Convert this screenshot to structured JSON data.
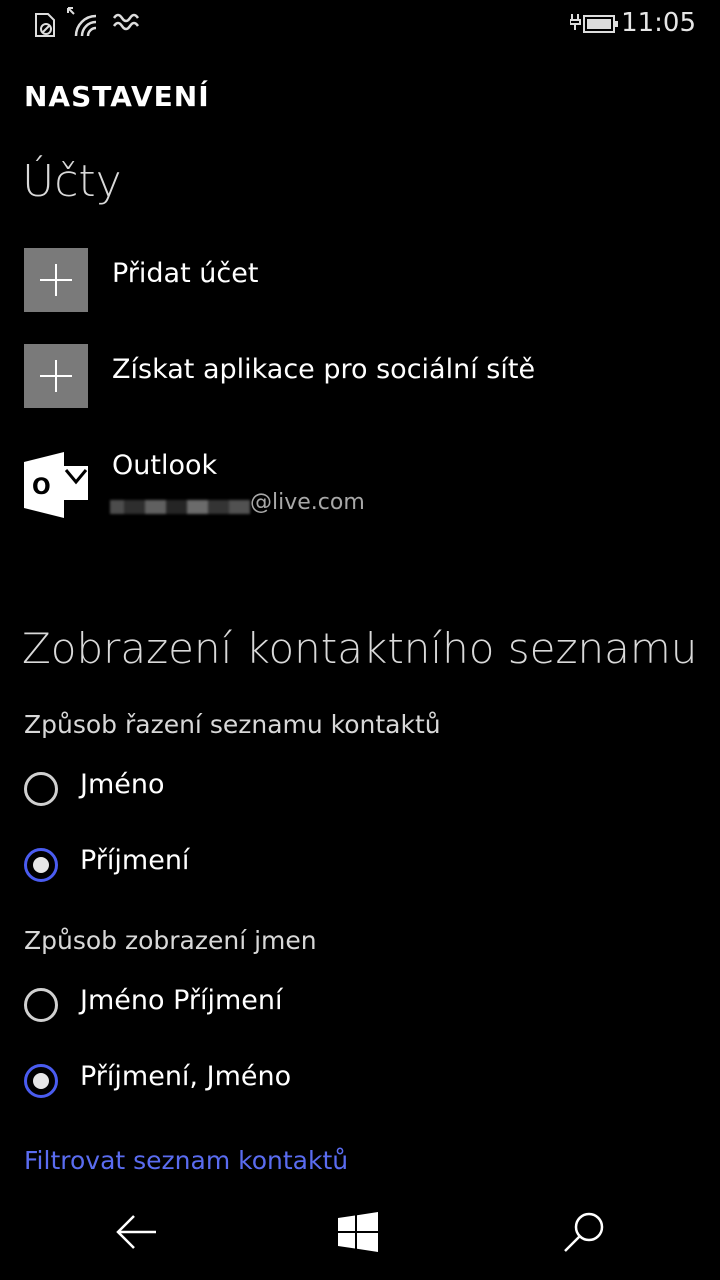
{
  "status": {
    "time": "11:05"
  },
  "header": {
    "title": "NASTAVENÍ"
  },
  "accounts": {
    "title": "Účty",
    "add_account": "Přidat účet",
    "get_social_apps": "Získat aplikace pro sociální sítě",
    "outlook": {
      "name": "Outlook",
      "email_suffix": "@live.com",
      "logo_letter": "O"
    }
  },
  "contact_view": {
    "title": "Zobrazení kontaktního seznamu",
    "sort_label": "Způsob řazení seznamu kontaktů",
    "sort_options": [
      {
        "label": "Jméno",
        "checked": false
      },
      {
        "label": "Příjmení",
        "checked": true
      }
    ],
    "display_label": "Způsob zobrazení jmen",
    "display_options": [
      {
        "label": "Jméno Příjmení",
        "checked": false
      },
      {
        "label": "Příjmení, Jméno",
        "checked": true
      }
    ],
    "filter_link": "Filtrovat seznam kontaktů"
  },
  "colors": {
    "accent": "#4a5cf0",
    "link": "#5a6cf0",
    "tile": "#7a7a7a"
  }
}
